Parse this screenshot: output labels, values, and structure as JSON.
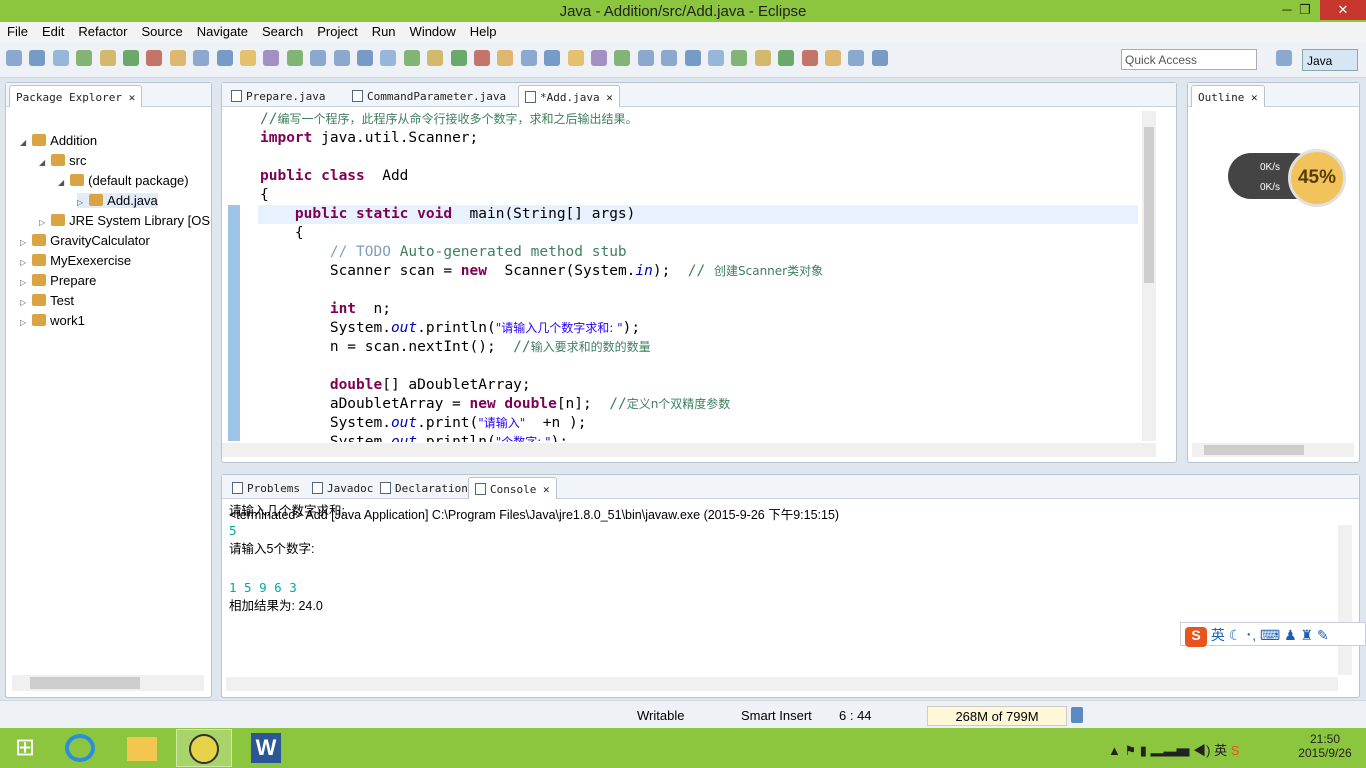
{
  "window": {
    "title": "Java - Addition/src/Add.java - Eclipse",
    "minimize": "─",
    "restore": "❐",
    "close": "✕"
  },
  "menu": [
    "File",
    "Edit",
    "Refactor",
    "Source",
    "Navigate",
    "Search",
    "Project",
    "Run",
    "Window",
    "Help"
  ],
  "toolbar": {
    "quick_access_placeholder": "Quick Access",
    "perspective": "Java"
  },
  "package_explorer": {
    "title": "Package Explorer",
    "items": [
      {
        "label": "Addition",
        "depth": 0,
        "arrow": "◢"
      },
      {
        "label": "src",
        "depth": 1,
        "arrow": "◢"
      },
      {
        "label": "(default package)",
        "depth": 2,
        "arrow": "◢"
      },
      {
        "label": "Add.java",
        "depth": 3,
        "arrow": "▷"
      },
      {
        "label": "JRE System Library [OS",
        "depth": 1,
        "arrow": "▷"
      },
      {
        "label": "GravityCalculator",
        "depth": 0,
        "arrow": "▷"
      },
      {
        "label": "MyExexercise",
        "depth": 0,
        "arrow": "▷"
      },
      {
        "label": "Prepare",
        "depth": 0,
        "arrow": "▷"
      },
      {
        "label": "Test",
        "depth": 0,
        "arrow": "▷"
      },
      {
        "label": "work1",
        "depth": 0,
        "arrow": "▷"
      }
    ]
  },
  "editor": {
    "tabs": [
      "Prepare.java",
      "CommandParameter.java",
      "*Add.java"
    ],
    "lines": [
      [
        [
          "cm",
          "//"
        ],
        [
          "cm cjk",
          "编写一个程序，此程序从命令行接收多个数字，求和之后输出结果。"
        ]
      ],
      [
        [
          "kw",
          "import"
        ],
        [
          "",
          " java.util.Scanner;"
        ]
      ],
      [],
      [
        [
          "kw",
          "public class"
        ],
        [
          "",
          "  Add"
        ]
      ],
      [
        [
          "",
          "{"
        ]
      ],
      [
        [
          "",
          "    "
        ],
        [
          "kw",
          "public static void"
        ],
        [
          "",
          "  main(String[] args)"
        ]
      ],
      [
        [
          "",
          "    {"
        ]
      ],
      [
        [
          "",
          "        "
        ],
        [
          "td",
          "// TODO "
        ],
        [
          "cm",
          "Auto-generated method stub"
        ]
      ],
      [
        [
          "",
          "        Scanner scan = "
        ],
        [
          "kw",
          "new"
        ],
        [
          "",
          "  Scanner(System."
        ],
        [
          "fi",
          "in"
        ],
        [
          "",
          ");  "
        ],
        [
          "cm",
          "// "
        ],
        [
          "cm cjk",
          "创建Scanner类对象"
        ]
      ],
      [],
      [
        [
          "",
          "        "
        ],
        [
          "kw",
          "int"
        ],
        [
          "",
          "  n;"
        ]
      ],
      [
        [
          "",
          "        System."
        ],
        [
          "fi",
          "out"
        ],
        [
          "",
          ".println("
        ],
        [
          "st cjk",
          "\"请输入几个数字求和: \""
        ],
        [
          "",
          ");"
        ]
      ],
      [
        [
          "",
          "        n = scan.nextInt();  "
        ],
        [
          "cm",
          "//"
        ],
        [
          "cm cjk",
          "输入要求和的数的数量"
        ]
      ],
      [],
      [
        [
          "",
          "        "
        ],
        [
          "kw",
          "double"
        ],
        [
          "",
          "[] aDoubletArray;"
        ]
      ],
      [
        [
          "",
          "        aDoubletArray = "
        ],
        [
          "kw",
          "new double"
        ],
        [
          "",
          "[n];  "
        ],
        [
          "cm",
          "//"
        ],
        [
          "cm cjk",
          "定义n个双精度参数"
        ]
      ],
      [
        [
          "",
          "        System."
        ],
        [
          "fi",
          "out"
        ],
        [
          "",
          ".print("
        ],
        [
          "st cjk",
          "\"请输入\""
        ],
        [
          "",
          "  +n );"
        ]
      ],
      [
        [
          "",
          "        System."
        ],
        [
          "fi",
          "out"
        ],
        [
          "",
          ".println("
        ],
        [
          "st cjk",
          "\"个数字: \""
        ],
        [
          "",
          ");"
        ]
      ]
    ]
  },
  "outline": {
    "title": "Outline",
    "net_up": "0K/s",
    "net_down": "0K/s",
    "cpu_percent": "45%"
  },
  "console_view": {
    "tabs": [
      "Problems",
      "Javadoc",
      "Declaration",
      "Console"
    ],
    "header": "<terminated> Add [Java Application] C:\\Program Files\\Java\\jre1.8.0_51\\bin\\javaw.exe (2015-9-26 下午9:15:15)",
    "lines": [
      [
        "out",
        "请输入几个数字求和:"
      ],
      [
        "in",
        "5"
      ],
      [
        "out",
        "请输入5个数字:"
      ],
      [
        "out",
        ""
      ],
      [
        "in",
        "1 5 9 6 3"
      ],
      [
        "out",
        "相加结果为: 24.0"
      ]
    ]
  },
  "ime": {
    "mode": "英"
  },
  "status": {
    "writable": "Writable",
    "insert": "Smart Insert",
    "position": "6 : 44",
    "heap": "268M of 799M"
  },
  "taskbar": {
    "time": "21:50",
    "date": "2015/9/26",
    "ime": "英"
  }
}
